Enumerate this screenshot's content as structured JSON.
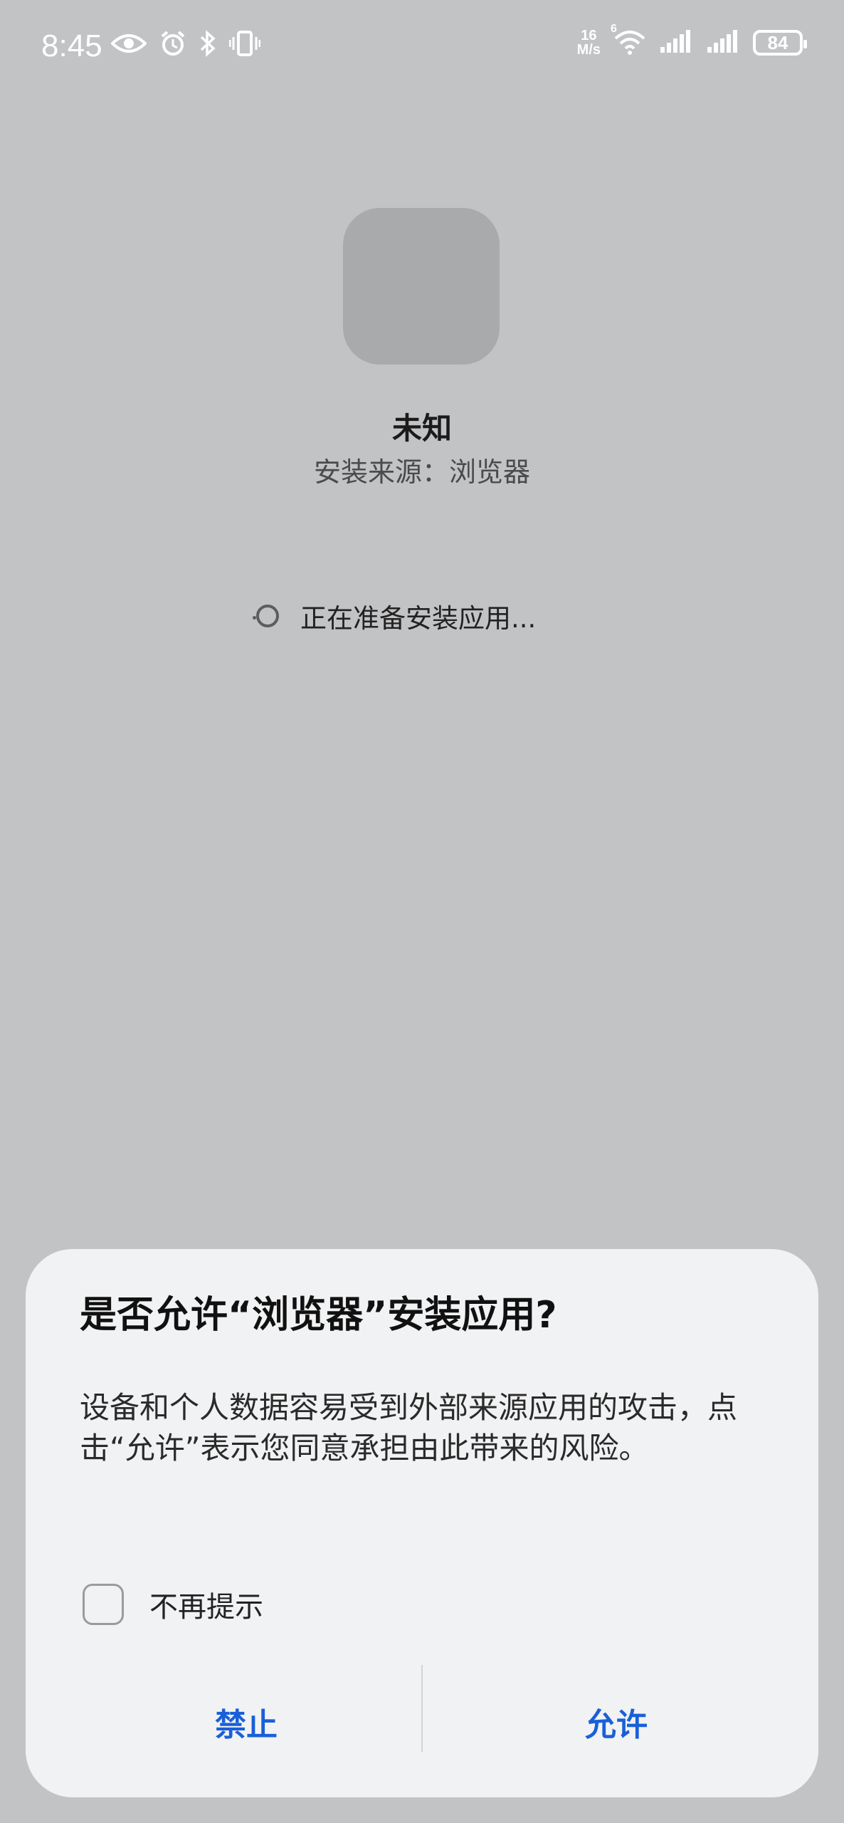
{
  "status_bar": {
    "time": "8:45",
    "net_speed_value": "16",
    "net_speed_unit": "M/s",
    "wifi_badge": "6",
    "battery": "84",
    "icons": [
      "eye-icon",
      "alarm-icon",
      "bluetooth-icon",
      "vibrate-icon",
      "wifi-icon",
      "signal-icon",
      "signal-icon",
      "battery-icon"
    ]
  },
  "app": {
    "name": "未知",
    "source": "安装来源：浏览器",
    "status": "正在准备安装应用..."
  },
  "dialog": {
    "title": "是否允许“浏览器”安装应用?",
    "body": "设备和个人数据容易受到外部来源应用的攻击，点击“允许”表示您同意承担由此带来的风险。",
    "checkbox_label": "不再提示",
    "checkbox_checked": false,
    "deny_label": "禁止",
    "allow_label": "允许",
    "accent_color": "#1a5fd8"
  }
}
